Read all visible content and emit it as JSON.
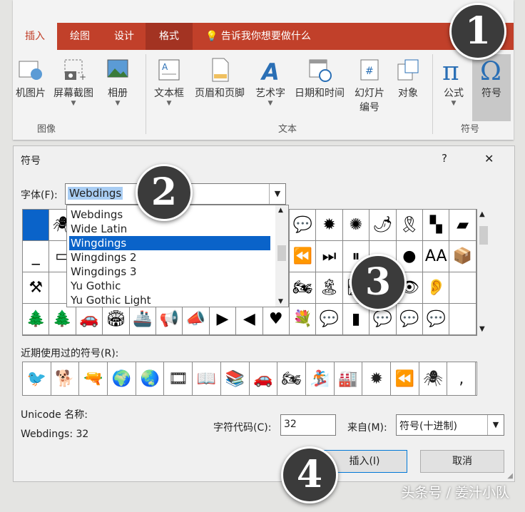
{
  "ribbon": {
    "tabs": [
      "插入",
      "绘图",
      "设计",
      "格式"
    ],
    "tell_me": "告诉我你想要做什么",
    "buttons": {
      "online_pictures": "机图片",
      "screenshot": "屏幕截图",
      "album": "相册",
      "textbox": "文本框",
      "header_footer": "页眉和页脚",
      "wordart": "艺术字",
      "datetime": "日期和时间",
      "slide_number_1": "幻灯片",
      "slide_number_2": "编号",
      "object": "对象",
      "equation": "公式",
      "symbol": "符号"
    },
    "groups": {
      "images": "图像",
      "text": "文本",
      "symbols": "符号"
    }
  },
  "dialog": {
    "title": "符号",
    "help": "?",
    "close": "✕",
    "font_label": "字体(F):",
    "font_value": "Webdings",
    "font_options": [
      "Webdings",
      "Wide Latin",
      "Wingdings",
      "Wingdings 2",
      "Wingdings 3",
      "Yu Gothic",
      "Yu Gothic Light"
    ],
    "selected_index": 2,
    "recent_label": "近期使用过的符号(R):",
    "unicode_name_label": "Unicode 名称:",
    "unicode_name_value": "Webdings: 32",
    "char_code_label": "字符代码(C):",
    "char_code_value": "32",
    "from_label": "来自(M):",
    "from_value": "符号(十进制)",
    "insert_button": "插入(I)",
    "cancel_button": "取消"
  },
  "symbol_rows": [
    [
      "",
      "🕷",
      "",
      "",
      "",
      "",
      "",
      "",
      "",
      "",
      "💬",
      "✹",
      "✺",
      "🌶",
      "🎗",
      "▚",
      "▰"
    ],
    [
      "_",
      "▭",
      "",
      "",
      "",
      "",
      "",
      "",
      "",
      "",
      "⏪",
      "⏭",
      "⏸",
      "",
      "●",
      "AA",
      "📦"
    ],
    [
      "⚒",
      "",
      "",
      "",
      "",
      "",
      "",
      "",
      "",
      "",
      "🏍",
      "🏝",
      "🛣",
      "🗻",
      "👁",
      "👂",
      ""
    ],
    [
      "🌲",
      "🌲",
      "🚗",
      "🏟",
      "🚢",
      "📢",
      "📣",
      "▶",
      "◀",
      "♥",
      "💐",
      "💬",
      "▮",
      "💬",
      "💬",
      "💬",
      ""
    ]
  ],
  "recent_symbols": [
    "🐦",
    "🐕",
    "🔫",
    "🌍",
    "🌏",
    "🎞",
    "📖",
    "📚",
    "🚗",
    "🏍",
    "🏂",
    "🏭",
    "✹",
    "⏪",
    "🕷",
    ","
  ],
  "badges": [
    "1",
    "2",
    "3",
    "4"
  ],
  "watermark": "头条号 / 姜汁小队",
  "colors": {
    "accent": "#c1402a",
    "selection": "#0a63c9"
  }
}
